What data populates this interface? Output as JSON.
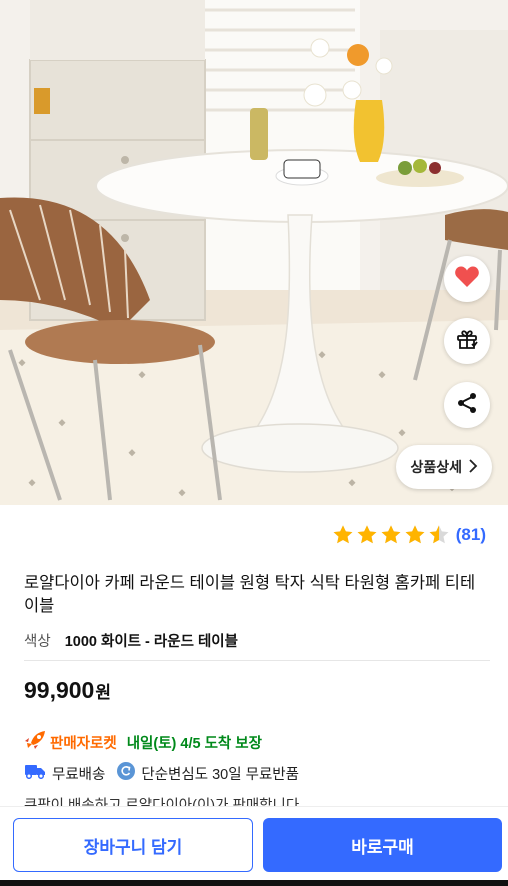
{
  "image_actions": {
    "like_icon": "heart-icon",
    "gift_icon": "gift-icon",
    "share_icon": "share-icon",
    "detail_label": "상품상세",
    "detail_icon": "chevron-right-icon"
  },
  "rating": {
    "stars": 4.5,
    "max_stars": 5,
    "review_count": "(81)"
  },
  "product": {
    "title": "로얄다이아 카페 라운드 테이블 원형 탁자 식탁 타원형 홈카페 티테이블",
    "option_label": "색상",
    "option_value": "1000 화이트 - 라운드 테이블",
    "price": "99,900",
    "currency": "원"
  },
  "delivery": {
    "rocket_label": "판매자로켓",
    "eta": "내일(토) 4/5 도착 보장",
    "free_shipping": "무료배송",
    "return_policy": "단순변심도 30일 무료반품",
    "seller_notice": "쿠팡이 배송하고 로얄다이아(이)가 판매합니다"
  },
  "actions": {
    "cart": "장바구니 담기",
    "buy": "바로구매"
  },
  "colors": {
    "accent": "#346aff",
    "rocket": "#ff6a00",
    "eta": "#00891a",
    "heart": "#f0504f",
    "star": "#ffb400"
  }
}
